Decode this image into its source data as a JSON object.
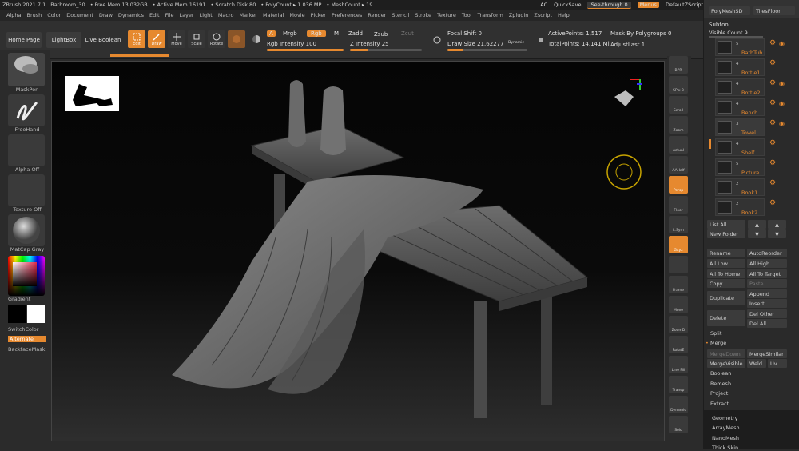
{
  "title_bar": {
    "app": "ZBrush 2021.7.1",
    "file": "Bathroom_30",
    "free_mem": "• Free Mem 13.032GB",
    "active_mem": "• Active Mem 16191",
    "scratch": "• Scratch Disk 80",
    "polycount": "• PolyCount ▸ 1.036 MP",
    "meshcount": "• MeshCount ▸ 19"
  },
  "top_right": {
    "ac": "AC",
    "quicksave": "QuickSave",
    "see_through": "See-through 0",
    "menus": "Menus",
    "script": "DefaultZScript"
  },
  "menu": [
    "Alpha",
    "Brush",
    "Color",
    "Document",
    "Draw",
    "Dynamics",
    "Edit",
    "File",
    "Layer",
    "Light",
    "Macro",
    "Marker",
    "Material",
    "Movie",
    "Picker",
    "Preferences",
    "Render",
    "Stencil",
    "Stroke",
    "Texture",
    "Tool",
    "Transform",
    "Zplugin",
    "Zscript",
    "Help"
  ],
  "toolbar": {
    "home_page": "Home Page",
    "lightbox": "LightBox",
    "live_boolean": "Live Boolean",
    "edit": "Edit",
    "draw": "Draw",
    "move": "Move",
    "scale": "Scale",
    "rotate": "Rotate",
    "a": "A",
    "mrgb": "Mrgb",
    "rgb": "Rgb",
    "m": "M",
    "rgb_intensity": "Rgb Intensity 100",
    "zadd": "Zadd",
    "zsub": "Zsub",
    "zcut": "Zcut",
    "z_intensity": "Z Intensity 25",
    "focal_shift": "Focal Shift 0",
    "draw_size": "Draw Size 21.62277",
    "dynamic": "Dynamic",
    "active_points": "ActivePoints: 1,517",
    "total_points": "TotalPoints: 14.141 Mil",
    "mask_polygroups": "Mask By Polygroups 0",
    "adjust_last": "AdjustLast 1",
    "rgb_intensity_value": 1.0,
    "z_intensity_value": 0.25
  },
  "left_shelf": {
    "maskpen": "MaskPen",
    "freehand": "FreeHand",
    "alpha_off": "Alpha Off",
    "texture_off": "Texture Off",
    "matcap": "MatCap Gray",
    "gradient": "Gradient",
    "switch_color": "SwitchColor",
    "alternate": "Alternate",
    "backface_mask": "BackfaceMask"
  },
  "right_shelf": [
    "BPR",
    "SPix 3",
    "Scroll",
    "Zoom",
    "Actual",
    "AAHalf",
    "Persp",
    "Floor",
    "L.Sym",
    "Gxyz",
    "",
    "Frame",
    "Move",
    "ZoomD",
    "RotatE",
    "Line Fill",
    "Transp",
    "Dynamic",
    "Solo"
  ],
  "panel": {
    "subtool_label": "Subtool",
    "visible_count": "Visible Count 9",
    "subtools": [
      {
        "count": "5",
        "name": "BathTub"
      },
      {
        "count": "4",
        "name": "Bottle1"
      },
      {
        "count": "4",
        "name": "Bottle2"
      },
      {
        "count": "4",
        "name": "Bench"
      },
      {
        "count": "3",
        "name": "Towel"
      },
      {
        "count": "4",
        "name": "Shelf"
      },
      {
        "count": "5",
        "name": "Picture"
      },
      {
        "count": "2",
        "name": "Book1"
      },
      {
        "count": "2",
        "name": "Book2"
      }
    ],
    "list_all": "List All",
    "new_folder": "New Folder",
    "rename": "Rename",
    "auto_reorder": "AutoReorder",
    "all_low": "All Low",
    "all_high": "All High",
    "all_to_home": "All To Home",
    "all_to_target": "All To Target",
    "copy": "Copy",
    "paste": "Paste",
    "duplicate": "Duplicate",
    "append": "Append",
    "insert": "Insert",
    "delete": "Delete",
    "del_other": "Del Other",
    "del_all": "Del All",
    "split": "Split",
    "merge": "Merge",
    "merge_down": "MergeDown",
    "merge_similar": "MergeSimilar",
    "merge_visible": "MergeVisible",
    "weld": "Weld",
    "uv": "Uv",
    "boolean": "Boolean",
    "remesh": "Remesh",
    "project": "Project",
    "extract": "Extract",
    "geometry": "Geometry",
    "arraymesh": "ArrayMesh",
    "nanomesh": "NanoMesh",
    "thick_skin": "Thick Skin",
    "top_btn1": "PolyMeshSD",
    "top_btn2": "TilesFloor"
  }
}
